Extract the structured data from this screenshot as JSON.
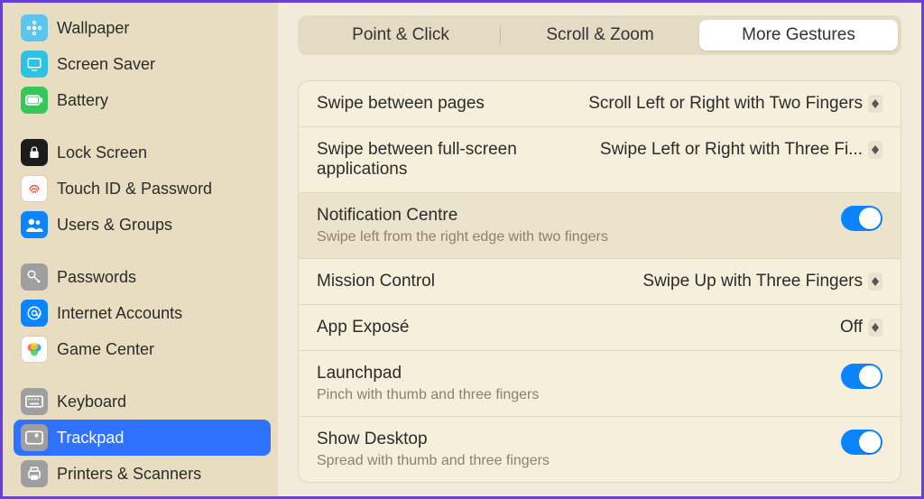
{
  "sidebar": {
    "items": [
      {
        "label": "Wallpaper"
      },
      {
        "label": "Screen Saver"
      },
      {
        "label": "Battery"
      },
      {
        "label": "Lock Screen"
      },
      {
        "label": "Touch ID & Password"
      },
      {
        "label": "Users & Groups"
      },
      {
        "label": "Passwords"
      },
      {
        "label": "Internet Accounts"
      },
      {
        "label": "Game Center"
      },
      {
        "label": "Keyboard"
      },
      {
        "label": "Trackpad"
      },
      {
        "label": "Printers & Scanners"
      }
    ]
  },
  "tabs": {
    "t0": "Point & Click",
    "t1": "Scroll & Zoom",
    "t2": "More Gestures"
  },
  "rows": {
    "swipe_pages": {
      "title": "Swipe between pages",
      "value": "Scroll Left or Right with Two Fingers"
    },
    "swipe_apps": {
      "title": "Swipe between full-screen applications",
      "value": "Swipe Left or Right with Three Fi..."
    },
    "notif": {
      "title": "Notification Centre",
      "sub": "Swipe left from the right edge with two fingers"
    },
    "mission": {
      "title": "Mission Control",
      "value": "Swipe Up with Three Fingers"
    },
    "expose": {
      "title": "App Exposé",
      "value": "Off"
    },
    "launchpad": {
      "title": "Launchpad",
      "sub": "Pinch with thumb and three fingers"
    },
    "desktop": {
      "title": "Show Desktop",
      "sub": "Spread with thumb and three fingers"
    }
  }
}
